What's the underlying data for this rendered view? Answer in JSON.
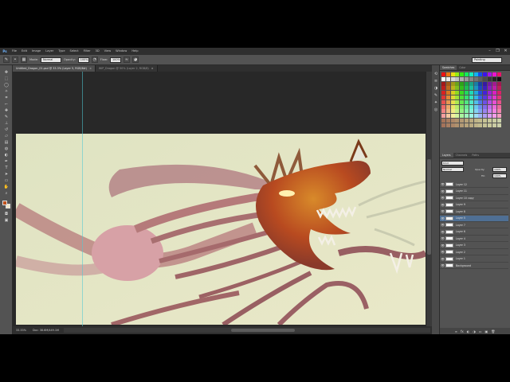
{
  "app": {
    "logo": "Ps"
  },
  "menu": [
    "File",
    "Edit",
    "Image",
    "Layer",
    "Type",
    "Select",
    "Filter",
    "3D",
    "View",
    "Window",
    "Help"
  ],
  "window_controls": [
    "–",
    "❐",
    "✕"
  ],
  "options_bar": {
    "mode_label": "Mode:",
    "mode_value": "Normal",
    "opacity_label": "Opacity:",
    "opacity_value": "100%",
    "flow_label": "Flow:",
    "flow_value": "100%",
    "workspace": "Painting"
  },
  "tabs": [
    {
      "label": "Untitled_Dragon_01.psd @ 33.3% (Layer 5, RGB/8#)",
      "active": true
    },
    {
      "label": "WIP_Dragon @ 50% (Layer 2, RGB/8)",
      "active": false
    }
  ],
  "status": {
    "zoom": "33.33%",
    "doc": "Doc: 38.6M/449.1M"
  },
  "panels": {
    "swatches_tabs": [
      "Swatches",
      "Color"
    ],
    "layers_tabs": [
      "Layers",
      "Channels",
      "Paths"
    ],
    "kind_label": "Kind",
    "blend_mode": "Normal",
    "opacity_label": "Opacity:",
    "opacity_value": "100%",
    "fill_label": "Fill:",
    "fill_value": "100%",
    "layers": [
      {
        "name": "Layer 12",
        "selected": false
      },
      {
        "name": "Layer 11",
        "selected": false
      },
      {
        "name": "Layer 10 copy",
        "selected": false
      },
      {
        "name": "Layer 9",
        "selected": false
      },
      {
        "name": "Layer 8",
        "selected": false
      },
      {
        "name": "Layer 5",
        "selected": true
      },
      {
        "name": "Layer 7",
        "selected": false
      },
      {
        "name": "Layer 6",
        "selected": false
      },
      {
        "name": "Layer 4",
        "selected": false
      },
      {
        "name": "Layer 3",
        "selected": false
      },
      {
        "name": "Layer 2",
        "selected": false
      },
      {
        "name": "Layer 1",
        "selected": false
      },
      {
        "name": "Background",
        "selected": false
      }
    ],
    "footer_icons": [
      "∞",
      "fx",
      "◐",
      "◑",
      "▭",
      "▣",
      "🗑"
    ]
  },
  "colors": {
    "foreground": "#c0521d",
    "background": "#f0e6c8",
    "canvas_bg": "#e3e6c6",
    "selection": "#4f6f94"
  }
}
